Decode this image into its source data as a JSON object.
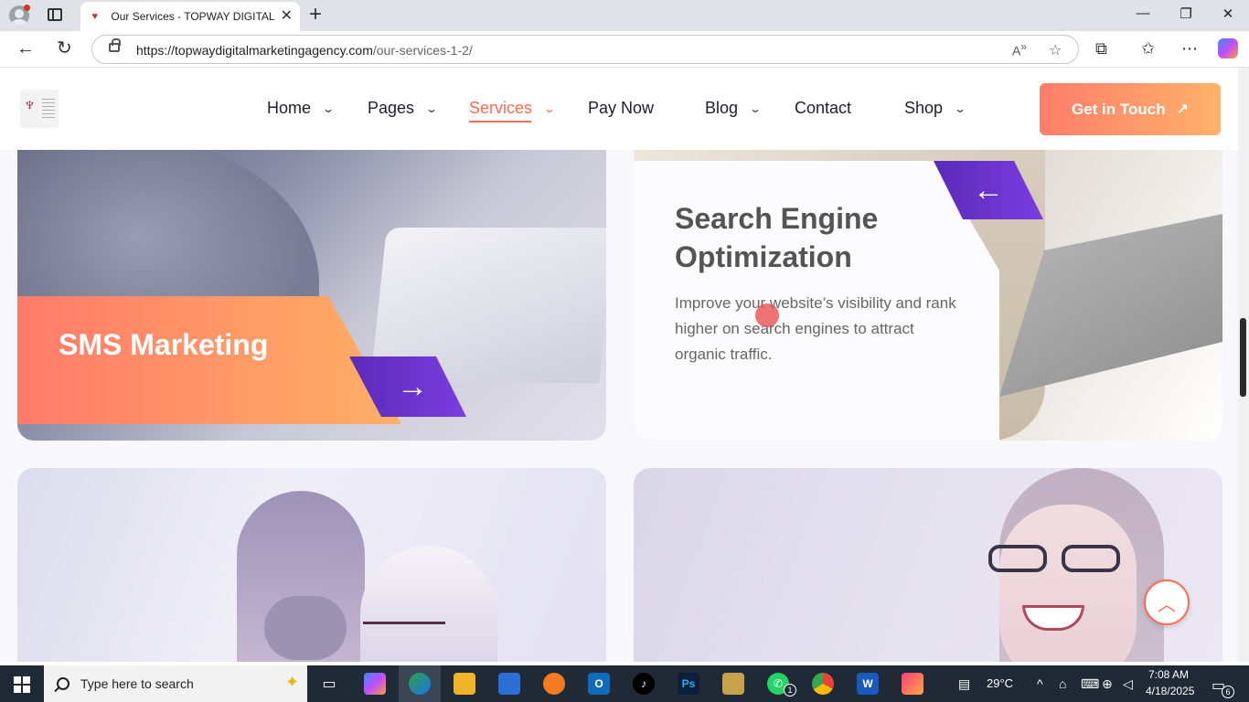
{
  "browser": {
    "tab_title": "Our Services - TOPWAY DIGITAL M",
    "url_host": "https://topwaydigitalmarketingagency.com",
    "url_path": "/our-services-1-2/"
  },
  "site": {
    "menu": [
      {
        "label": "Home",
        "dropdown": true
      },
      {
        "label": "Pages",
        "dropdown": true
      },
      {
        "label": "Services",
        "dropdown": true,
        "active": true
      },
      {
        "label": "Pay Now",
        "dropdown": false
      },
      {
        "label": "Blog",
        "dropdown": true
      },
      {
        "label": "Contact",
        "dropdown": false
      },
      {
        "label": "Shop",
        "dropdown": true
      }
    ],
    "cta_label": "Get in Touch",
    "accent_color": "#ff6a52",
    "purple_color": "#5b2bb8"
  },
  "cards": {
    "sms": {
      "title": "SMS Marketing"
    },
    "seo": {
      "title": "Search Engine Optimization",
      "description": "Improve your website’s visibility and rank higher on search engines to attract organic traffic."
    }
  },
  "taskbar": {
    "search_placeholder": "Type here to search",
    "weather": "29°C",
    "time": "7:08 AM",
    "date": "4/18/2025",
    "notification_count": "6",
    "whatsapp_badge": "1"
  }
}
